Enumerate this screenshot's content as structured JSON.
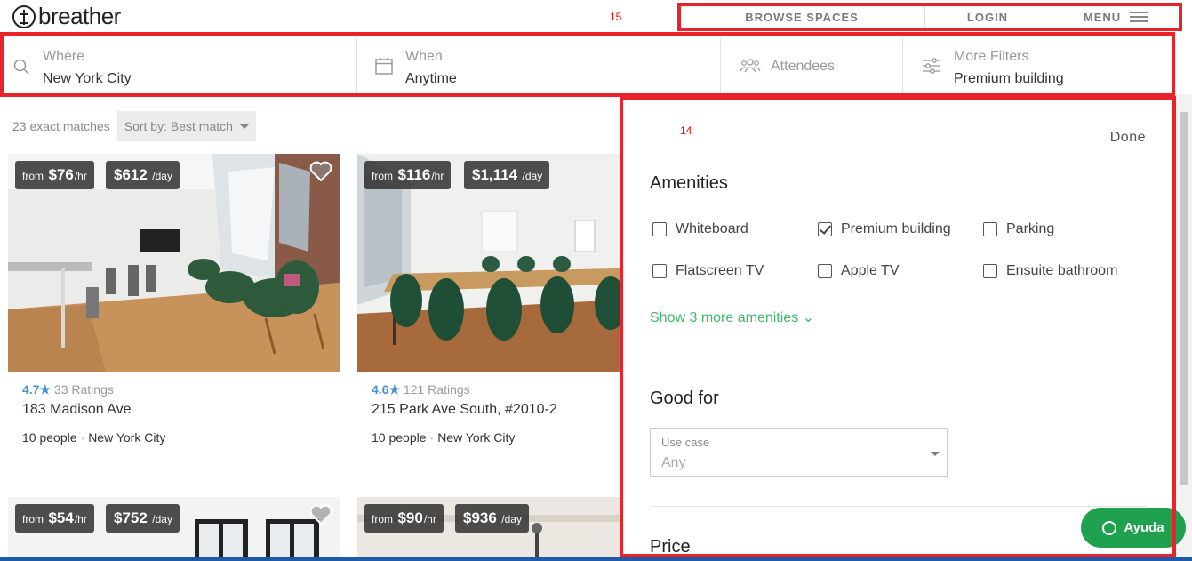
{
  "brand": {
    "name": "breather"
  },
  "annotations": {
    "a1": "15",
    "a2": "14",
    "a3": "14"
  },
  "nav": {
    "browse": "BROWSE SPACES",
    "login": "LOGIN",
    "menu": "MENU"
  },
  "search": {
    "where": {
      "label": "Where",
      "value": "New York City"
    },
    "when": {
      "label": "When",
      "value": "Anytime"
    },
    "attendees": {
      "label": "Attendees"
    },
    "filters": {
      "label": "More Filters",
      "value": "Premium building"
    }
  },
  "results": {
    "count": "23 exact matches",
    "sort_label": "Sort by:",
    "sort_value": "Best match"
  },
  "cards": [
    {
      "from": "from",
      "hourly": "$76",
      "hr": "/hr",
      "daily": "$612",
      "day": "/day",
      "score": "4.7",
      "ratings": "33 Ratings",
      "address": "183 Madison Ave",
      "people": "10 people",
      "city": "New York City"
    },
    {
      "from": "from",
      "hourly": "$116",
      "hr": "/hr",
      "daily": "$1,114",
      "day": "/day",
      "score": "4.6",
      "ratings": "121 Ratings",
      "address": "215 Park Ave South, #2010-2",
      "people": "10 people",
      "city": "New York City"
    },
    {
      "from": "from",
      "hourly": "$54",
      "hr": "/hr",
      "daily": "$752",
      "day": "/day"
    },
    {
      "from": "from",
      "hourly": "$90",
      "hr": "/hr",
      "daily": "$936",
      "day": "/day"
    }
  ],
  "panel": {
    "done": "Done",
    "amenities_title": "Amenities",
    "amenities": [
      {
        "label": "Whiteboard",
        "checked": false
      },
      {
        "label": "Premium building",
        "checked": true
      },
      {
        "label": "Parking",
        "checked": false
      },
      {
        "label": "Flatscreen TV",
        "checked": false
      },
      {
        "label": "Apple TV",
        "checked": false
      },
      {
        "label": "Ensuite bathroom",
        "checked": false
      }
    ],
    "more_amenities": "Show 3 more amenities ⌄",
    "good_for_title": "Good for",
    "use_case_label": "Use case",
    "use_case_value": "Any",
    "price_title": "Price"
  },
  "chat": {
    "label": "Ayuda"
  },
  "colors": {
    "accent_green": "#3eb96a",
    "chat_green": "#1fa14f",
    "rating_blue": "#4a90d9",
    "annotation_red": "#e8232a"
  }
}
